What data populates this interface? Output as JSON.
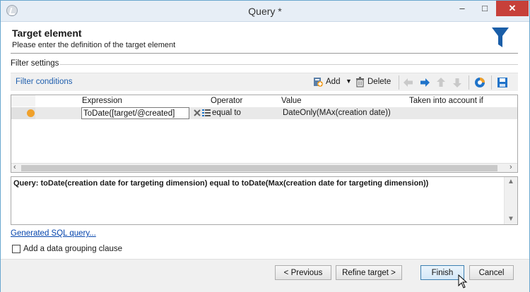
{
  "window": {
    "title": "Query *",
    "minimize": "–",
    "maximize": "□",
    "close": "✕"
  },
  "header": {
    "title": "Target element",
    "subtitle": "Please enter the definition of the target element"
  },
  "section": {
    "label": "Filter settings"
  },
  "toolbar": {
    "filter_conditions": "Filter conditions",
    "add_label": "Add",
    "delete_label": "Delete"
  },
  "grid": {
    "columns": [
      "Expression",
      "Operator",
      "Value",
      "Taken into account if"
    ],
    "rows": [
      {
        "expression": "ToDate([target/@created]",
        "operator": "equal to",
        "value": "DateOnly(MAx(creation date))"
      }
    ]
  },
  "query": {
    "text": "Query: toDate(creation date for targeting dimension) equal to toDate(Max(creation date for targeting dimension))"
  },
  "links": {
    "generated_sql": "Generated SQL query..."
  },
  "options": {
    "grouping_clause": "Add a data grouping clause",
    "grouping_checked": false
  },
  "footer": {
    "previous": "< Previous",
    "refine": "Refine target >",
    "finish": "Finish",
    "cancel": "Cancel"
  },
  "colors": {
    "accent": "#1f5fae",
    "status_dot": "#f0a12b",
    "close_button": "#c7403a",
    "funnel": "#1a5ea8"
  }
}
